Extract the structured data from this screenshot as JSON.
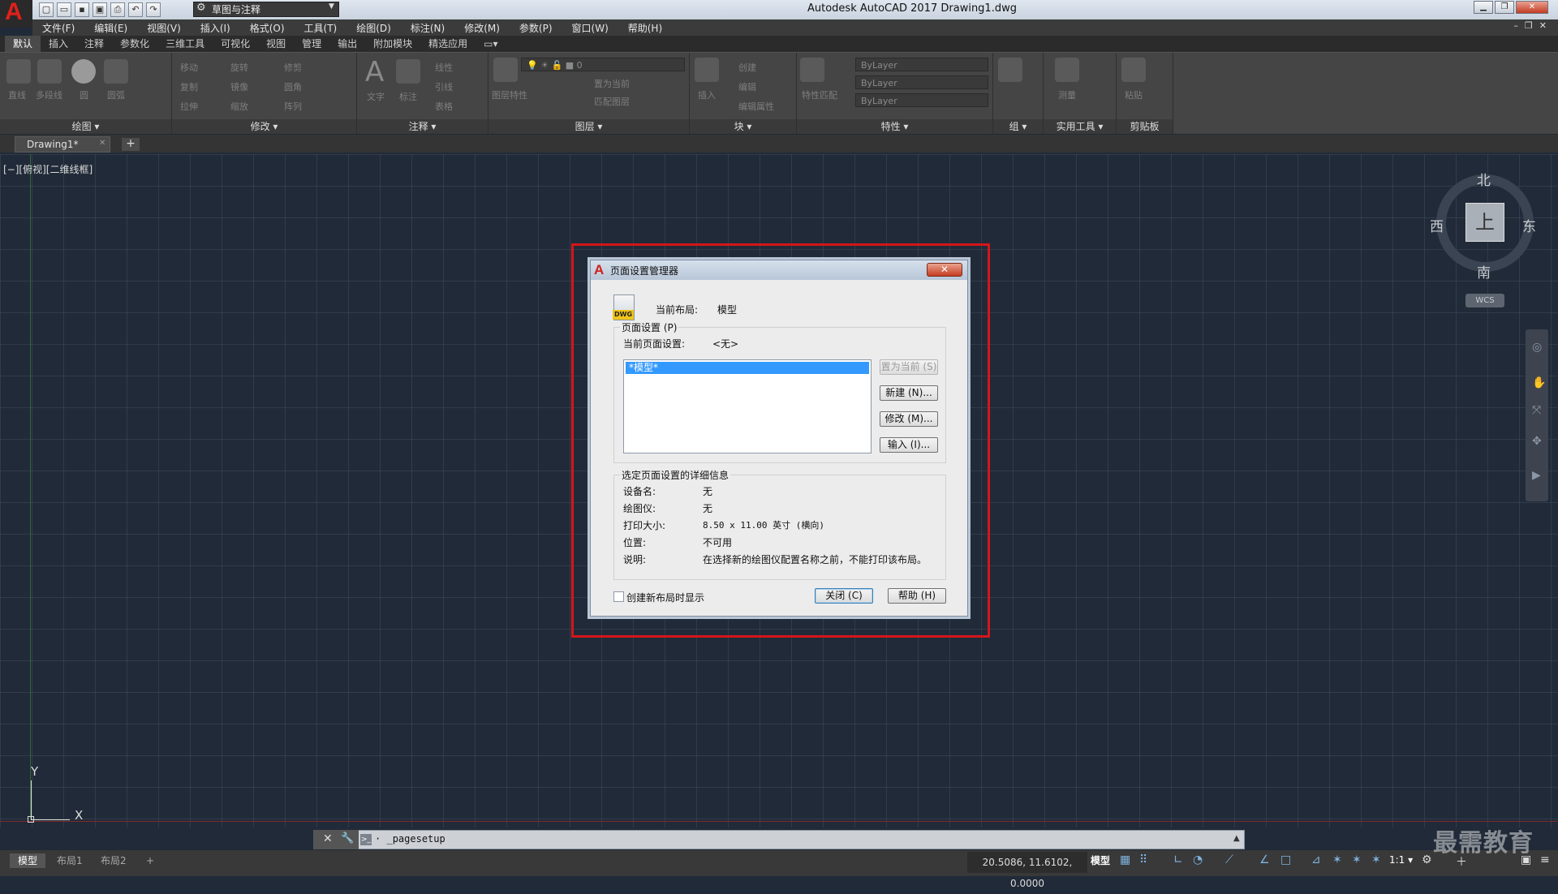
{
  "app": {
    "title": "Autodesk AutoCAD 2017    Drawing1.dwg",
    "logo": "A",
    "workspace": "草图与注释"
  },
  "menu": [
    "文件(F)",
    "编辑(E)",
    "视图(V)",
    "插入(I)",
    "格式(O)",
    "工具(T)",
    "绘图(D)",
    "标注(N)",
    "修改(M)",
    "参数(P)",
    "窗口(W)",
    "帮助(H)"
  ],
  "ribbon": {
    "tabs": [
      "默认",
      "插入",
      "注释",
      "参数化",
      "三维工具",
      "可视化",
      "视图",
      "管理",
      "输出",
      "附加模块",
      "精选应用"
    ],
    "active_tab": "默认",
    "panels": {
      "draw": "绘图",
      "modify": "修改",
      "annotate": "注释",
      "layers": "图层",
      "block": "块",
      "properties": "特性",
      "group": "组",
      "utilities": "实用工具",
      "clipboard": "剪贴板"
    },
    "draw_tools": [
      "直线",
      "多段线",
      "圆",
      "圆弧"
    ],
    "modify_tools": [
      "移动",
      "旋转",
      "修剪",
      "复制",
      "镜像",
      "圆角",
      "拉伸",
      "缩放",
      "阵列"
    ],
    "annotate_tools": [
      "文字",
      "标注",
      "线性",
      "引线",
      "表格"
    ],
    "layer_tools": [
      "图层特性",
      "置为当前",
      "匹配图层"
    ],
    "layer_value": "0",
    "block_tools": [
      "插入",
      "创建",
      "编辑",
      "编辑属性"
    ],
    "property_tools": [
      "特性匹配"
    ],
    "bylayer": [
      "ByLayer",
      "ByLayer",
      "ByLayer"
    ],
    "utility_tools": [
      "测量"
    ],
    "clipboard_tools": [
      "粘贴"
    ]
  },
  "doc_tab": {
    "name": "Drawing1*",
    "close": "✕",
    "add": "+"
  },
  "viewport": {
    "label": "[−][俯视][二维线框]",
    "ucs": {
      "x": "X",
      "y": "Y"
    },
    "viewcube": {
      "north": "北",
      "south": "南",
      "east": "东",
      "west": "西",
      "face": "上",
      "wcs": "WCS"
    }
  },
  "dialog": {
    "title": "页面设置管理器",
    "close": "✕",
    "current_layout_label": "当前布局:",
    "current_layout_value": "模型",
    "page_setup_group": "页面设置 (P)",
    "current_setup_label": "当前页面设置:",
    "current_setup_value": "<无>",
    "list_items": [
      "*模型*"
    ],
    "buttons": {
      "set_current": "置为当前 (S)",
      "new": "新建 (N)...",
      "modify": "修改 (M)...",
      "import": "输入 (I)...",
      "close": "关闭 (C)",
      "help": "帮助 (H)"
    },
    "details_title": "选定页面设置的详细信息",
    "details": [
      {
        "label": "设备名:",
        "value": "无"
      },
      {
        "label": "绘图仪:",
        "value": "无"
      },
      {
        "label": "打印大小:",
        "value": "8.50 x 11.00 英寸 (横向)"
      },
      {
        "label": "位置:",
        "value": "不可用"
      },
      {
        "label": "说明:",
        "value": "在选择新的绘图仪配置名称之前，不能打印该布局。"
      }
    ],
    "checkbox_label": "创建新布局时显示"
  },
  "command_line": {
    "text": "_pagesetup",
    "prefix": "·"
  },
  "status": {
    "layout_tabs": [
      "模型",
      "布局1",
      "布局2"
    ],
    "add_layout": "+",
    "coords": "20.5086, 11.6102, 0.0000",
    "model": "模型",
    "scale": "1:1 ▾"
  },
  "watermark": "最需教育"
}
